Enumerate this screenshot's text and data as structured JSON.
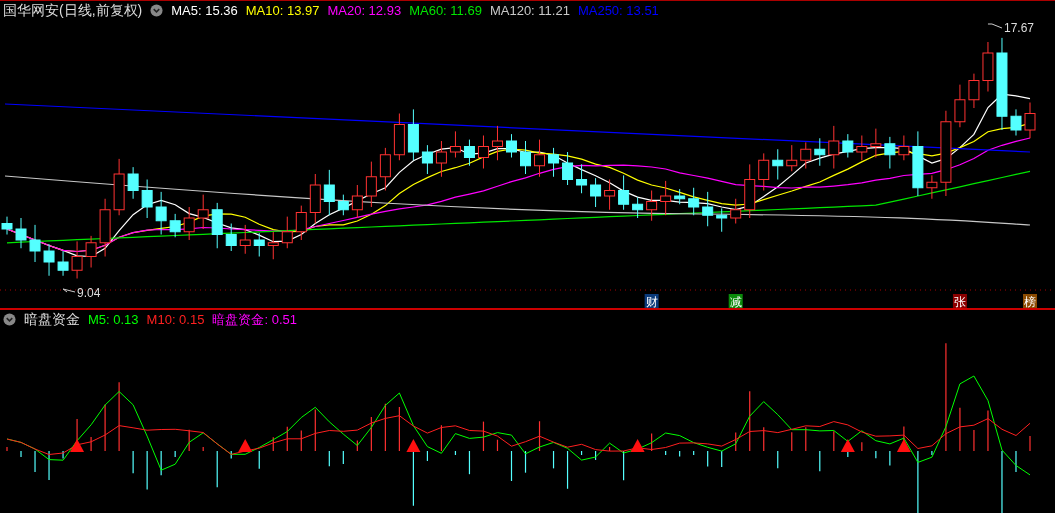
{
  "price_panel": {
    "title": "国华网安(日线,前复权)",
    "moving_averages": [
      {
        "label": "MA5: 15.36",
        "color": "#ffffff"
      },
      {
        "label": "MA10: 13.97",
        "color": "#ffff00"
      },
      {
        "label": "MA20: 12.93",
        "color": "#ff00ff"
      },
      {
        "label": "MA60: 11.69",
        "color": "#00e600"
      },
      {
        "label": "MA120: 11.21",
        "color": "#c8c8c8"
      },
      {
        "label": "MA250: 13.51",
        "color": "#0000ff"
      }
    ],
    "high_label": "17.67",
    "low_label": "9.04",
    "event_badges": [
      {
        "label": "财",
        "color": "#0a3a7a"
      },
      {
        "label": "减",
        "color": "#0a8a0a"
      },
      {
        "label": "张",
        "color": "#8a0000"
      },
      {
        "label": "榜",
        "color": "#8a4a00"
      }
    ]
  },
  "indicator_panel": {
    "title": "暗盘资金",
    "series": [
      {
        "label": "M5: 0.13",
        "color": "#00ff00"
      },
      {
        "label": "M10: 0.15",
        "color": "#ff2020"
      },
      {
        "label": "暗盘资金: 0.51",
        "color": "#ff00ff"
      }
    ]
  }
}
